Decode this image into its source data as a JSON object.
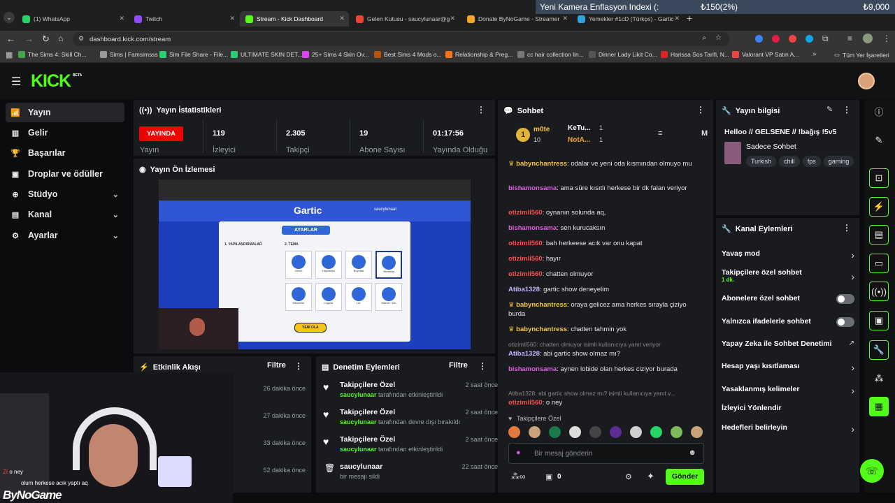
{
  "browser": {
    "tabs": [
      {
        "label": "(1) WhatsApp",
        "color": "#25d366"
      },
      {
        "label": "Twitch",
        "color": "#9146ff"
      },
      {
        "label": "Stream - Kick Dashboard",
        "color": "#53fc18"
      },
      {
        "label": "Gelen Kutusu - saucylunaar@g",
        "color": "#ea4335"
      },
      {
        "label": "Donate ByNoGame - Streamer",
        "color": "#f5a623"
      },
      {
        "label": "Yemekler #1cD (Türkçe) - Gartic",
        "color": "#2aa3e0"
      }
    ],
    "new_tab": "+",
    "ticker": {
      "label": "Yeni Kamera Enflasyon Indexi (:",
      "value1": "₺150(2%)",
      "value2": "₺9,000"
    },
    "url": "dashboard.kick.com/stream",
    "bookmarks": [
      "The Sims 4: Skill Ch...",
      "Sims | Famsimsss",
      "Sim File Share - File...",
      "ULTIMATE SKIN DET...",
      "25+ Sims 4 Skin Ov...",
      "Best Sims 4 Mods o...",
      "Relationship & Preg...",
      "cc hair collection lin...",
      "Dinner Lady Likit Co...",
      "Harissa Sos Tarifi, N...",
      "Valorant VP Satın A..."
    ],
    "bookmarks_more": "»",
    "all_bookmarks": "Tüm Yer İşaretleri"
  },
  "kick": {
    "logo": "KICK",
    "logo_beta": "BETA",
    "sidebar": [
      {
        "label": "Yayın",
        "icon": "broadcast-icon",
        "active": true
      },
      {
        "label": "Gelir",
        "icon": "revenue-icon"
      },
      {
        "label": "Başarılar",
        "icon": "trophy-icon"
      },
      {
        "label": "Droplar ve ödüller",
        "icon": "gift-icon"
      },
      {
        "label": "Stüdyo",
        "icon": "studio-icon",
        "expand": true
      },
      {
        "label": "Kanal",
        "icon": "channel-icon",
        "expand": true
      },
      {
        "label": "Ayarlar",
        "icon": "settings-icon",
        "expand": true
      }
    ],
    "stats": {
      "title": "Yayın İstatistikleri",
      "live_badge": "YAYINDA",
      "live_label": "Yayın",
      "items": [
        {
          "value": "119",
          "label": "İzleyici"
        },
        {
          "value": "2.305",
          "label": "Takipçi"
        },
        {
          "value": "19",
          "label": "Abone Sayısı"
        },
        {
          "value": "01:17:56",
          "label": "Yayında Olduğu"
        }
      ]
    },
    "preview": {
      "title": "Yayın Ön İzlemesi",
      "game_logo": "Gartic",
      "settings_title": "AYARLAR",
      "section1": "1. YAPILANDIRMALAR",
      "section2": "2. TEMA",
      "themes": [
        "Genel",
        "Hayvanlar",
        "Boyutlar",
        "Yemekler",
        "Meslekler",
        "Logolar",
        "LoL",
        "Marvel / DC"
      ],
      "start_button": "YENİ OLA",
      "username": "saucylunaar"
    },
    "events": {
      "title": "Etkinlik Akışı",
      "filter": "Filtre",
      "rows": [
        "26 dakika önce",
        "27 dakika önce",
        "33 dakika önce",
        "52 dakika önce"
      ]
    },
    "mod": {
      "title": "Denetim Eylemleri",
      "filter": "Filtre",
      "rows": [
        {
          "title": "Takipçilere Özel",
          "user": "saucylunaar",
          "desc": "tarafından etkinleştirildi",
          "time": "2 saat önce",
          "icon": "heart-icon"
        },
        {
          "title": "Takipçilere Özel",
          "user": "saucylunaar",
          "desc": "tarafından devre dışı bırakıldı",
          "time": "2 saat önce",
          "icon": "heart-icon"
        },
        {
          "title": "Takipçilere Özel",
          "user": "saucylunaar",
          "desc": "tarafından etkinleştirildi",
          "time": "2 saat önce",
          "icon": "heart-icon"
        },
        {
          "title": "saucylunaar",
          "user": "",
          "desc": "bir mesajı sildi",
          "time": "22 saat önce",
          "icon": "trash-icon"
        }
      ]
    },
    "chat": {
      "title": "Sohbet",
      "leaderboard": {
        "rank": "1",
        "first": {
          "name": "m0te",
          "count": "10"
        },
        "second": {
          "name": "KeTu...",
          "count": "1"
        },
        "third": {
          "name": "NotA...",
          "count": "1"
        },
        "letter": "M"
      },
      "messages": [
        {
          "user": "babynchantress",
          "color": "#f5c542",
          "badge": true,
          "text": "odalar ve yeni oda kısmından olmuyo mu"
        },
        {
          "user": "bishamonsama",
          "color": "#e05ce0",
          "text": "ama süre kısıtlı herkese bir dk falan veriyor"
        },
        {
          "user": "otizimli560",
          "color": "#ff4a4a",
          "text": "oynanın solunda aq,"
        },
        {
          "user": "bishamonsama",
          "color": "#e05ce0",
          "text": "sen kurucaksın"
        },
        {
          "user": "otizimli560",
          "color": "#ff4a4a",
          "text": "bah herkeese acık var onu kapat"
        },
        {
          "user": "otizimli560",
          "color": "#ff4a4a",
          "text": "hayır"
        },
        {
          "user": "otizimli560",
          "color": "#ff4a4a",
          "text": "chatten olmuyor"
        },
        {
          "user": "Atiba1328",
          "color": "#c9b3ff",
          "text": "gartic show deneyelim"
        },
        {
          "user": "babynchantress",
          "color": "#f5c542",
          "badge": true,
          "text": "oraya gelicez ama herkes sırayla çiziyo burda"
        },
        {
          "user": "babynchantress",
          "color": "#f5c542",
          "badge": true,
          "text": "chatten tahmin yok"
        },
        {
          "reply": "otizimli560: chatten olmuyor isimli kullanıcıya yanıt veriyor",
          "user": "Atiba1328",
          "color": "#c9b3ff",
          "text": "abi gartic show olmaz mı?"
        },
        {
          "user": "bishamonsama",
          "color": "#e05ce0",
          "text": "aynen lobide olan herkes ciziyor burada"
        },
        {
          "reply": "Atiba1328: abi gartic show olmaz mı? isimli kullanıcıya yanıt v...",
          "user": "otizimli560",
          "color": "#ff4a4a",
          "text": "o ney"
        },
        {
          "user": "otizimli560",
          "color": "#ff4a4a",
          "text": "olum herkese acık yaptı aq"
        }
      ],
      "followers_only": "Takipçilere Özel",
      "input_placeholder": "Bir mesaj gönderin",
      "points": "0",
      "send": "Gönder"
    },
    "info": {
      "title": "Yayın bilgisi",
      "stream_title": "Helloo // GELSENE // !bağış !5v5",
      "category": "Sadece Sohbet",
      "tags": [
        "Turkish",
        "chill",
        "fps",
        "gaming"
      ]
    },
    "channel_actions": {
      "title": "Kanal Eylemleri",
      "items": [
        {
          "label": "Yavaş mod",
          "type": "arrow"
        },
        {
          "label": "Takipçilere özel sohbet",
          "sub": "1 dk.",
          "type": "arrow"
        },
        {
          "label": "Abonelere özel sohbet",
          "type": "toggle"
        },
        {
          "label": "Yalnızca ifadelerle sohbet",
          "type": "toggle"
        },
        {
          "label": "Yapay Zeka ile Sohbet Denetimi",
          "type": "external"
        },
        {
          "label": "Hesap yaşı kısıtlaması",
          "type": "arrow"
        },
        {
          "label": "Yasaklanmış kelimeler",
          "type": "arrow"
        },
        {
          "label": "İzleyici Yönlendir",
          "type": "none"
        },
        {
          "label": "Hedefleri belirleyin",
          "type": "arrow"
        }
      ]
    },
    "webcam": {
      "overlay_brand": "ByNoGame",
      "overlay_line1": "ZI",
      "overlay_msg1": "o ney",
      "overlay_msg2": "olum herkese acık yaptı aq"
    }
  },
  "colors": {
    "accent": "#53fc18",
    "panel": "#191b1f",
    "bg": "#0b0c0d",
    "live": "#eb0400"
  }
}
